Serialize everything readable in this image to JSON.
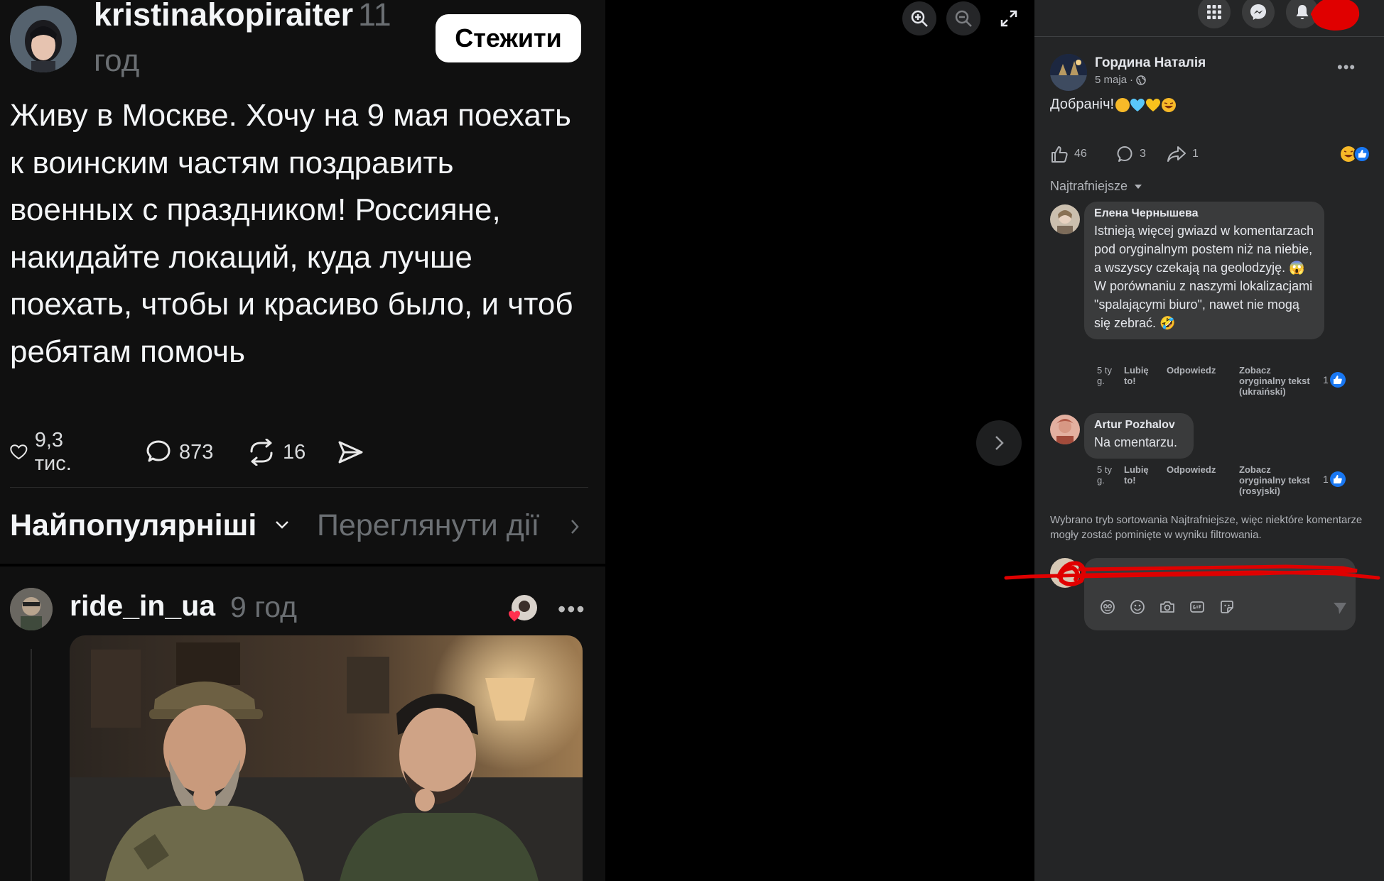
{
  "threads_post": {
    "username": "kristinakopiraiter",
    "time": "11",
    "time_unit": "год",
    "follow_label": "Стежити",
    "text": "Живу в Москве. Хочу на 9 мая поехать к воинским частям поздравить военных с праздником! Россияне, накидайте локаций, куда лучше поехать, чтобы и красиво было, и чтоб ребятам помочь",
    "likes": "9,3 тис.",
    "comments": "873",
    "reposts": "16",
    "sort_label": "Найпопулярніші",
    "activity_label": "Переглянути дії"
  },
  "threads_reply": {
    "username": "ride_in_ua",
    "time": "9 год"
  },
  "fb_post": {
    "author": "Гордина Наталія",
    "date": "5 maja",
    "text": "Добраніч!",
    "likes": "46",
    "comments": "3",
    "shares": "1",
    "sort_label": "Najtrafniejsze"
  },
  "comments": [
    {
      "author": "Елена Чернышева",
      "text": "Istnieją więcej gwiazd w komentarzach pod oryginalnym postem niż na niebie, a wszyscy czekają na geolodzyję. 😱 W porównaniu z naszymi lokalizacjami \"spalającymi biuro\", nawet nie mogą się zebrać. 🤣",
      "time": "5 ty g.",
      "like_label": "Lubię to!",
      "reply_label": "Odpowiedz",
      "original_label": "Zobacz oryginalny tekst (ukraiński)",
      "reactions": "1"
    },
    {
      "author": "Artur Pozhalov",
      "text": "Na cmentarzu.",
      "time": "5 ty g.",
      "like_label": "Lubię to!",
      "reply_label": "Odpowiedz",
      "original_label": "Zobacz oryginalny tekst (rosyjski)",
      "reactions": "1"
    }
  ],
  "filter_note": "Wybrano tryb sortowania Najtrafniejsze, więc niektóre komentarze mogły zostać pominięte w wyniku filtrowania.",
  "colors": {
    "threads_bg": "#101010",
    "fb_panel_bg": "#242526",
    "fb_blue": "#1877f2",
    "scribble_red": "#e00000"
  }
}
